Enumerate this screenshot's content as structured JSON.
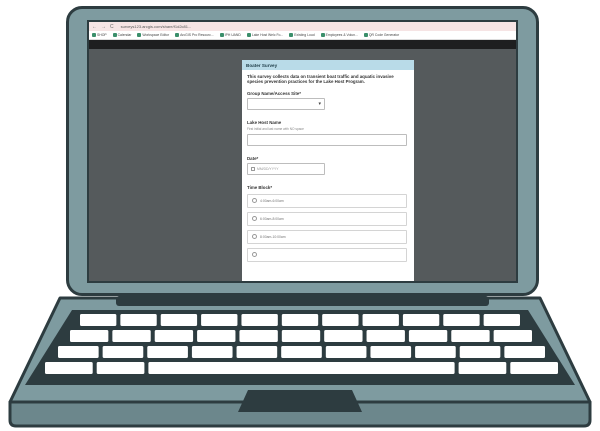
{
  "browser": {
    "url": "surveys123.arcgis.com/share/f1d2c81...",
    "nav": [
      "←",
      "→",
      "C"
    ],
    "bookmarks": [
      "SHOP",
      "Calendar",
      "Workspace Editor",
      "ArcGIS Pro Resourc...",
      "IPH UAND",
      "Lake Host Welc Fo...",
      "Existing Loud",
      "Employees & Volun...",
      "QR Code Generator"
    ]
  },
  "form": {
    "title": "Boater Survey",
    "description": "This survey collects data on transient boat traffic and aquatic invasive species prevention practices for the Lake Host Program.",
    "group_label": "Group Name/Access Site*",
    "host_label": "Lake Host Name",
    "host_hint": "First initial and last name with NO space",
    "date_label": "Date*",
    "date_placeholder": "MM/DD/YYYY",
    "timeblock_label": "Time Block*",
    "timeblocks": [
      "4:00am-6:00am",
      "6:00am-8:00am",
      "8:00am-10:00am"
    ]
  },
  "colors": {
    "laptop_body": "#7e9ba0",
    "outline": "#2d3c40",
    "screen_bg": "#555a5c",
    "form_header": "#b9dbe8"
  }
}
